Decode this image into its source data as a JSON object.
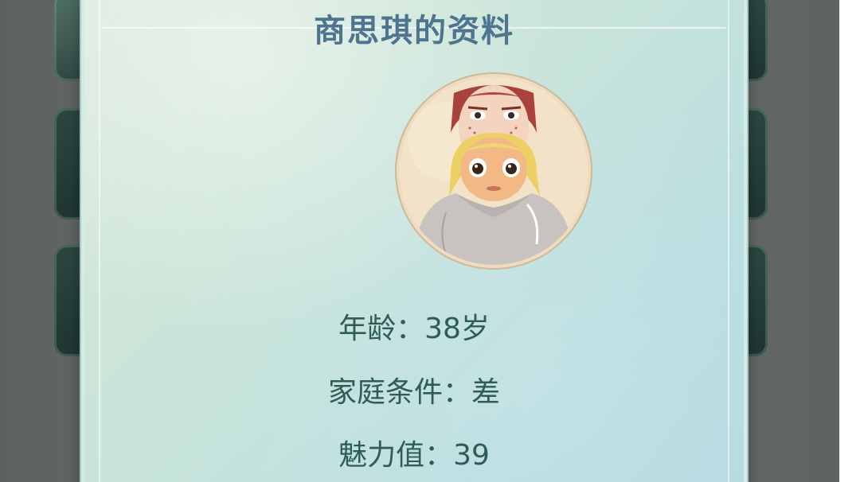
{
  "profile": {
    "title": "商思琪的资料",
    "age_line": "年龄：38岁",
    "family_line": "家庭条件：差",
    "charm_line": "魅力值：39"
  },
  "avatar": {
    "icon": "character-portrait-icon"
  },
  "colors": {
    "title": "#4d7590",
    "info_text": "#2f5d55",
    "panel": "#c4e2dc",
    "backdrop": "#646966"
  }
}
